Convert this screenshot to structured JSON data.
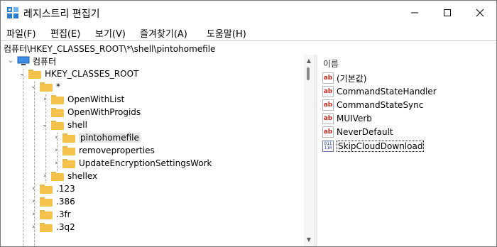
{
  "window": {
    "title": "레지스트리 편집기",
    "icon": "registry-editor-icon"
  },
  "menu": [
    "파일(F)",
    "편집(E)",
    "보기(V)",
    "즐겨찾기(A)",
    "도움말(H)"
  ],
  "address": "컴퓨터\\HKEY_CLASSES_ROOT\\*\\shell\\pintohomefile",
  "tree": {
    "computer": "컴퓨터",
    "hkcr": "HKEY_CLASSES_ROOT",
    "star": "*",
    "openwithlist": "OpenWithList",
    "openwithprogids": "OpenWithProgids",
    "shell": "shell",
    "pintohomefile": "pintohomefile",
    "removeproperties": "removeproperties",
    "updateencryption": "UpdateEncryptionSettingsWork",
    "shellex": "shellex",
    "k123": ".123",
    "k386": ".386",
    "k3fr": ".3fr",
    "k3q2": ".3q2"
  },
  "values": {
    "header": "이름",
    "items": [
      {
        "name": "(기본값)",
        "type": "string"
      },
      {
        "name": "CommandStateHandler",
        "type": "string"
      },
      {
        "name": "CommandStateSync",
        "type": "string"
      },
      {
        "name": "MUIVerb",
        "type": "string"
      },
      {
        "name": "NeverDefault",
        "type": "string"
      },
      {
        "name": "SkipCloudDownload",
        "type": "binary"
      }
    ]
  }
}
